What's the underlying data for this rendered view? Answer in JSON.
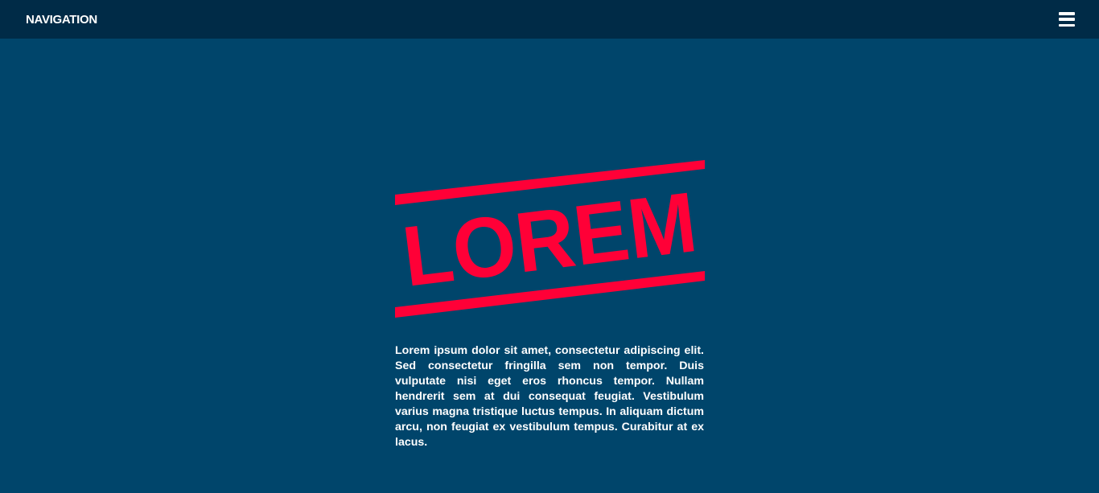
{
  "nav": {
    "title": "NAVIGATION",
    "menu_icon": "hamburger-menu-icon"
  },
  "hero": {
    "logo_text": "LOREM",
    "logo_color": "#ff0037"
  },
  "content": {
    "paragraph": "Lorem ipsum dolor sit amet, consectetur adipiscing elit. Sed consectetur fringilla sem non tempor. Duis vulputate nisi eget eros rhoncus tempor. Nullam hendrerit sem at dui consequat feugiat. Vestibulum varius magna tristique luctus tempus. In aliquam dictum arcu, non feugiat ex vestibulum tempus. Curabitur at ex lacus."
  },
  "colors": {
    "background": "#00456b",
    "navbar": "#002b47",
    "text": "#ffffff",
    "accent": "#ff0037"
  }
}
